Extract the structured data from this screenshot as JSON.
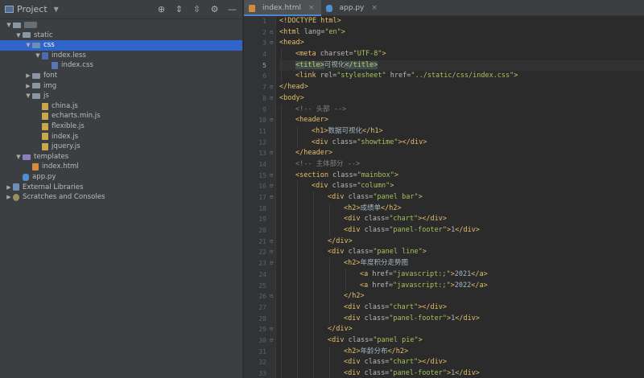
{
  "project": {
    "title": "Project",
    "tree": [
      {
        "label": "",
        "depth": 0,
        "arrow": "open",
        "icon": "folder",
        "blurred": true
      },
      {
        "label": "static",
        "depth": 1,
        "arrow": "open",
        "icon": "folder"
      },
      {
        "label": "css",
        "depth": 2,
        "arrow": "open",
        "icon": "folder-blue",
        "selected": true
      },
      {
        "label": "index.less",
        "depth": 3,
        "arrow": "open",
        "icon": "less"
      },
      {
        "label": "index.css",
        "depth": 4,
        "arrow": "",
        "icon": "css"
      },
      {
        "label": "font",
        "depth": 2,
        "arrow": "closed",
        "icon": "folder"
      },
      {
        "label": "img",
        "depth": 2,
        "arrow": "closed",
        "icon": "folder"
      },
      {
        "label": "js",
        "depth": 2,
        "arrow": "open",
        "icon": "folder"
      },
      {
        "label": "china.js",
        "depth": 3,
        "arrow": "",
        "icon": "js"
      },
      {
        "label": "echarts.min.js",
        "depth": 3,
        "arrow": "",
        "icon": "js"
      },
      {
        "label": "flexible.js",
        "depth": 3,
        "arrow": "",
        "icon": "js"
      },
      {
        "label": "index.js",
        "depth": 3,
        "arrow": "",
        "icon": "js"
      },
      {
        "label": "jquery.js",
        "depth": 3,
        "arrow": "",
        "icon": "js"
      },
      {
        "label": "templates",
        "depth": 1,
        "arrow": "open",
        "icon": "folder-purple"
      },
      {
        "label": "index.html",
        "depth": 2,
        "arrow": "",
        "icon": "html"
      },
      {
        "label": "app.py",
        "depth": 1,
        "arrow": "",
        "icon": "py"
      },
      {
        "label": "External Libraries",
        "depth": 0,
        "arrow": "closed",
        "icon": "lib"
      },
      {
        "label": "Scratches and Consoles",
        "depth": 0,
        "arrow": "closed",
        "icon": "scratch"
      }
    ]
  },
  "tabs": [
    {
      "label": "index.html",
      "icon": "html",
      "active": true
    },
    {
      "label": "app.py",
      "icon": "py",
      "active": false
    }
  ],
  "code": {
    "current_line": 5,
    "lines": [
      {
        "n": "1",
        "indent": 0,
        "tokens": [
          [
            "doct",
            "<!DOCTYPE html>"
          ]
        ]
      },
      {
        "n": "2",
        "indent": 0,
        "fold": true,
        "tokens": [
          [
            "tag",
            "<html "
          ],
          [
            "attr",
            "lang="
          ],
          [
            "val",
            "\"en\""
          ],
          [
            "tag",
            ">"
          ]
        ]
      },
      {
        "n": "3",
        "indent": 0,
        "fold": true,
        "tokens": [
          [
            "tag",
            "<head>"
          ]
        ]
      },
      {
        "n": "4",
        "indent": 1,
        "tokens": [
          [
            "tag",
            "<meta "
          ],
          [
            "attr",
            "charset="
          ],
          [
            "val",
            "\"UTF-8\""
          ],
          [
            "tag",
            ">"
          ]
        ]
      },
      {
        "n": "5",
        "indent": 1,
        "tokens": [
          [
            "tag hl",
            "<title>"
          ],
          [
            "txt",
            "可视化"
          ],
          [
            "tag hl",
            "</title>"
          ]
        ]
      },
      {
        "n": "6",
        "indent": 1,
        "tokens": [
          [
            "tag",
            "<link "
          ],
          [
            "attr",
            "rel="
          ],
          [
            "val",
            "\"stylesheet\""
          ],
          [
            "attr",
            " href="
          ],
          [
            "val",
            "\"../static/css/index.css\""
          ],
          [
            "tag",
            ">"
          ]
        ]
      },
      {
        "n": "7",
        "indent": 0,
        "fold": true,
        "tokens": [
          [
            "tag",
            "</head>"
          ]
        ]
      },
      {
        "n": "8",
        "indent": 0,
        "fold": true,
        "tokens": [
          [
            "tag",
            "<body>"
          ]
        ]
      },
      {
        "n": "9",
        "indent": 1,
        "tokens": [
          [
            "cmt",
            "<!-- 头部 -->"
          ]
        ]
      },
      {
        "n": "10",
        "indent": 1,
        "fold": true,
        "tokens": [
          [
            "tag",
            "<header>"
          ]
        ]
      },
      {
        "n": "11",
        "indent": 2,
        "tokens": [
          [
            "tag",
            "<h1>"
          ],
          [
            "txt",
            "数据可视化"
          ],
          [
            "tag",
            "</h1>"
          ]
        ]
      },
      {
        "n": "12",
        "indent": 2,
        "tokens": [
          [
            "tag",
            "<div "
          ],
          [
            "attr",
            "class="
          ],
          [
            "val",
            "\"showtime\""
          ],
          [
            "tag",
            "></div>"
          ]
        ]
      },
      {
        "n": "13",
        "indent": 1,
        "fold": true,
        "tokens": [
          [
            "tag",
            "</header>"
          ]
        ]
      },
      {
        "n": "14",
        "indent": 1,
        "tokens": [
          [
            "cmt",
            "<!-- 主体部分 -->"
          ]
        ]
      },
      {
        "n": "15",
        "indent": 1,
        "fold": true,
        "tokens": [
          [
            "tag",
            "<section "
          ],
          [
            "attr",
            "class="
          ],
          [
            "val",
            "\"mainbox\""
          ],
          [
            "tag",
            ">"
          ]
        ]
      },
      {
        "n": "16",
        "indent": 2,
        "fold": true,
        "tokens": [
          [
            "tag",
            "<div "
          ],
          [
            "attr",
            "class="
          ],
          [
            "val",
            "\"column\""
          ],
          [
            "tag",
            ">"
          ]
        ]
      },
      {
        "n": "17",
        "indent": 3,
        "fold": true,
        "tokens": [
          [
            "tag",
            "<div "
          ],
          [
            "attr",
            "class="
          ],
          [
            "val",
            "\"panel bar\""
          ],
          [
            "tag",
            ">"
          ]
        ]
      },
      {
        "n": "18",
        "indent": 4,
        "tokens": [
          [
            "tag",
            "<h2>"
          ],
          [
            "txt",
            "成绩单"
          ],
          [
            "tag",
            "</h2>"
          ]
        ]
      },
      {
        "n": "19",
        "indent": 4,
        "tokens": [
          [
            "tag",
            "<div "
          ],
          [
            "attr",
            "class="
          ],
          [
            "val",
            "\"chart\""
          ],
          [
            "tag",
            "></div>"
          ]
        ]
      },
      {
        "n": "20",
        "indent": 4,
        "tokens": [
          [
            "tag",
            "<div "
          ],
          [
            "attr",
            "class="
          ],
          [
            "val",
            "\"panel-footer\""
          ],
          [
            "tag",
            ">"
          ],
          [
            "txt",
            "1"
          ],
          [
            "tag",
            "</div>"
          ]
        ]
      },
      {
        "n": "21",
        "indent": 3,
        "fold": true,
        "tokens": [
          [
            "tag",
            "</div>"
          ]
        ]
      },
      {
        "n": "22",
        "indent": 3,
        "fold": true,
        "tokens": [
          [
            "tag",
            "<div "
          ],
          [
            "attr",
            "class="
          ],
          [
            "val",
            "\"panel line\""
          ],
          [
            "tag",
            ">"
          ]
        ]
      },
      {
        "n": "23",
        "indent": 4,
        "fold": true,
        "tokens": [
          [
            "tag",
            "<h2>"
          ],
          [
            "txt",
            "年度积分走势图"
          ]
        ]
      },
      {
        "n": "24",
        "indent": 5,
        "tokens": [
          [
            "tag",
            "<a "
          ],
          [
            "attr",
            "href="
          ],
          [
            "val",
            "\"javascript:;\""
          ],
          [
            "tag",
            ">"
          ],
          [
            "txt",
            "2021"
          ],
          [
            "tag",
            "</a>"
          ]
        ]
      },
      {
        "n": "25",
        "indent": 5,
        "tokens": [
          [
            "tag",
            "<a "
          ],
          [
            "attr",
            "href="
          ],
          [
            "val",
            "\"javascript:;\""
          ],
          [
            "tag",
            ">"
          ],
          [
            "txt",
            "2022"
          ],
          [
            "tag",
            "</a>"
          ]
        ]
      },
      {
        "n": "26",
        "indent": 4,
        "fold": true,
        "tokens": [
          [
            "tag",
            "</h2>"
          ]
        ]
      },
      {
        "n": "27",
        "indent": 4,
        "tokens": [
          [
            "tag",
            "<div "
          ],
          [
            "attr",
            "class="
          ],
          [
            "val",
            "\"chart\""
          ],
          [
            "tag",
            "></div>"
          ]
        ]
      },
      {
        "n": "28",
        "indent": 4,
        "tokens": [
          [
            "tag",
            "<div "
          ],
          [
            "attr",
            "class="
          ],
          [
            "val",
            "\"panel-footer\""
          ],
          [
            "tag",
            ">"
          ],
          [
            "txt",
            "1"
          ],
          [
            "tag",
            "</div>"
          ]
        ]
      },
      {
        "n": "29",
        "indent": 3,
        "fold": true,
        "tokens": [
          [
            "tag",
            "</div>"
          ]
        ]
      },
      {
        "n": "30",
        "indent": 3,
        "fold": true,
        "tokens": [
          [
            "tag",
            "<div "
          ],
          [
            "attr",
            "class="
          ],
          [
            "val",
            "\"panel pie\""
          ],
          [
            "tag",
            ">"
          ]
        ]
      },
      {
        "n": "31",
        "indent": 4,
        "tokens": [
          [
            "tag",
            "<h2>"
          ],
          [
            "txt",
            "年龄分布"
          ],
          [
            "tag",
            "</h2>"
          ]
        ]
      },
      {
        "n": "32",
        "indent": 4,
        "tokens": [
          [
            "tag",
            "<div "
          ],
          [
            "attr",
            "class="
          ],
          [
            "val",
            "\"chart\""
          ],
          [
            "tag",
            "></div>"
          ]
        ]
      },
      {
        "n": "33",
        "indent": 4,
        "tokens": [
          [
            "tag",
            "<div "
          ],
          [
            "attr",
            "class="
          ],
          [
            "val",
            "\"panel-footer\""
          ],
          [
            "tag",
            ">"
          ],
          [
            "txt",
            "1"
          ],
          [
            "tag",
            "</div>"
          ]
        ]
      }
    ]
  }
}
